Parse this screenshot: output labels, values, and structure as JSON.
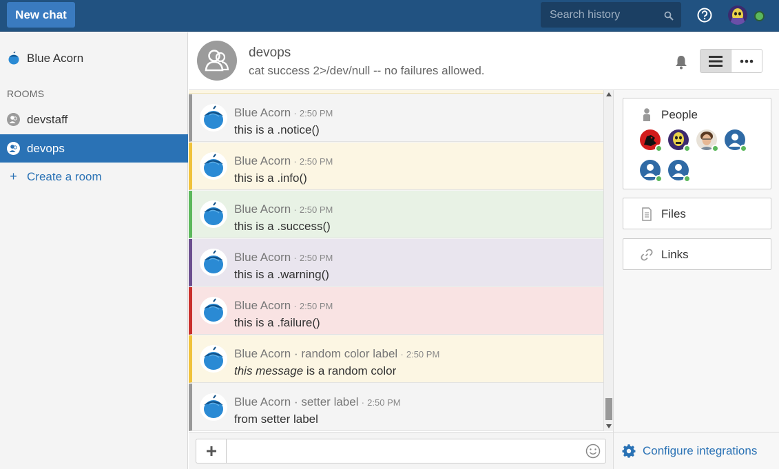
{
  "topbar": {
    "new_chat_label": "New chat",
    "search_placeholder": "Search history"
  },
  "sidebar": {
    "org_name": "Blue Acorn",
    "rooms_header": "ROOMS",
    "rooms": [
      {
        "label": "devstaff",
        "active": false
      },
      {
        "label": "devops",
        "active": true
      }
    ],
    "create_room_label": "Create a room"
  },
  "header": {
    "room_name": "devops",
    "topic": "cat success 2>/dev/null -- no failures allowed."
  },
  "messages": [
    {
      "sender": "Blue Acorn",
      "time": "2:50 PM",
      "body": "this is a .notice()",
      "color": "#999999",
      "bg": "#f4f4f4"
    },
    {
      "sender": "Blue Acorn",
      "time": "2:50 PM",
      "body": "this is a .info()",
      "color": "#f0c23b",
      "bg": "#fcf6e3"
    },
    {
      "sender": "Blue Acorn",
      "time": "2:50 PM",
      "body": "this is a .success()",
      "color": "#5cb85c",
      "bg": "#e8f2e5"
    },
    {
      "sender": "Blue Acorn",
      "time": "2:50 PM",
      "body": "this is a .warning()",
      "color": "#6c4f8f",
      "bg": "#e9e5ee"
    },
    {
      "sender": "Blue Acorn",
      "time": "2:50 PM",
      "body": "this is a .failure()",
      "color": "#c9302c",
      "bg": "#f9e3e3"
    },
    {
      "sender": "Blue Acorn · random color label",
      "time": "2:50 PM",
      "body_em": "this message",
      "body_rest": " is a random color",
      "color": "#f0c23b",
      "bg": "#fcf6e3"
    },
    {
      "sender": "Blue Acorn · setter label",
      "time": "2:50 PM",
      "body": "from setter label",
      "color": "#999999",
      "bg": "#f4f4f4"
    }
  ],
  "right_panel": {
    "people_label": "People",
    "files_label": "Files",
    "links_label": "Links"
  },
  "composer": {
    "placeholder": ""
  },
  "configure_label": "Configure integrations",
  "colors": {
    "topbar": "#215281",
    "accent": "#2a72b5",
    "online": "#5cb85c"
  }
}
